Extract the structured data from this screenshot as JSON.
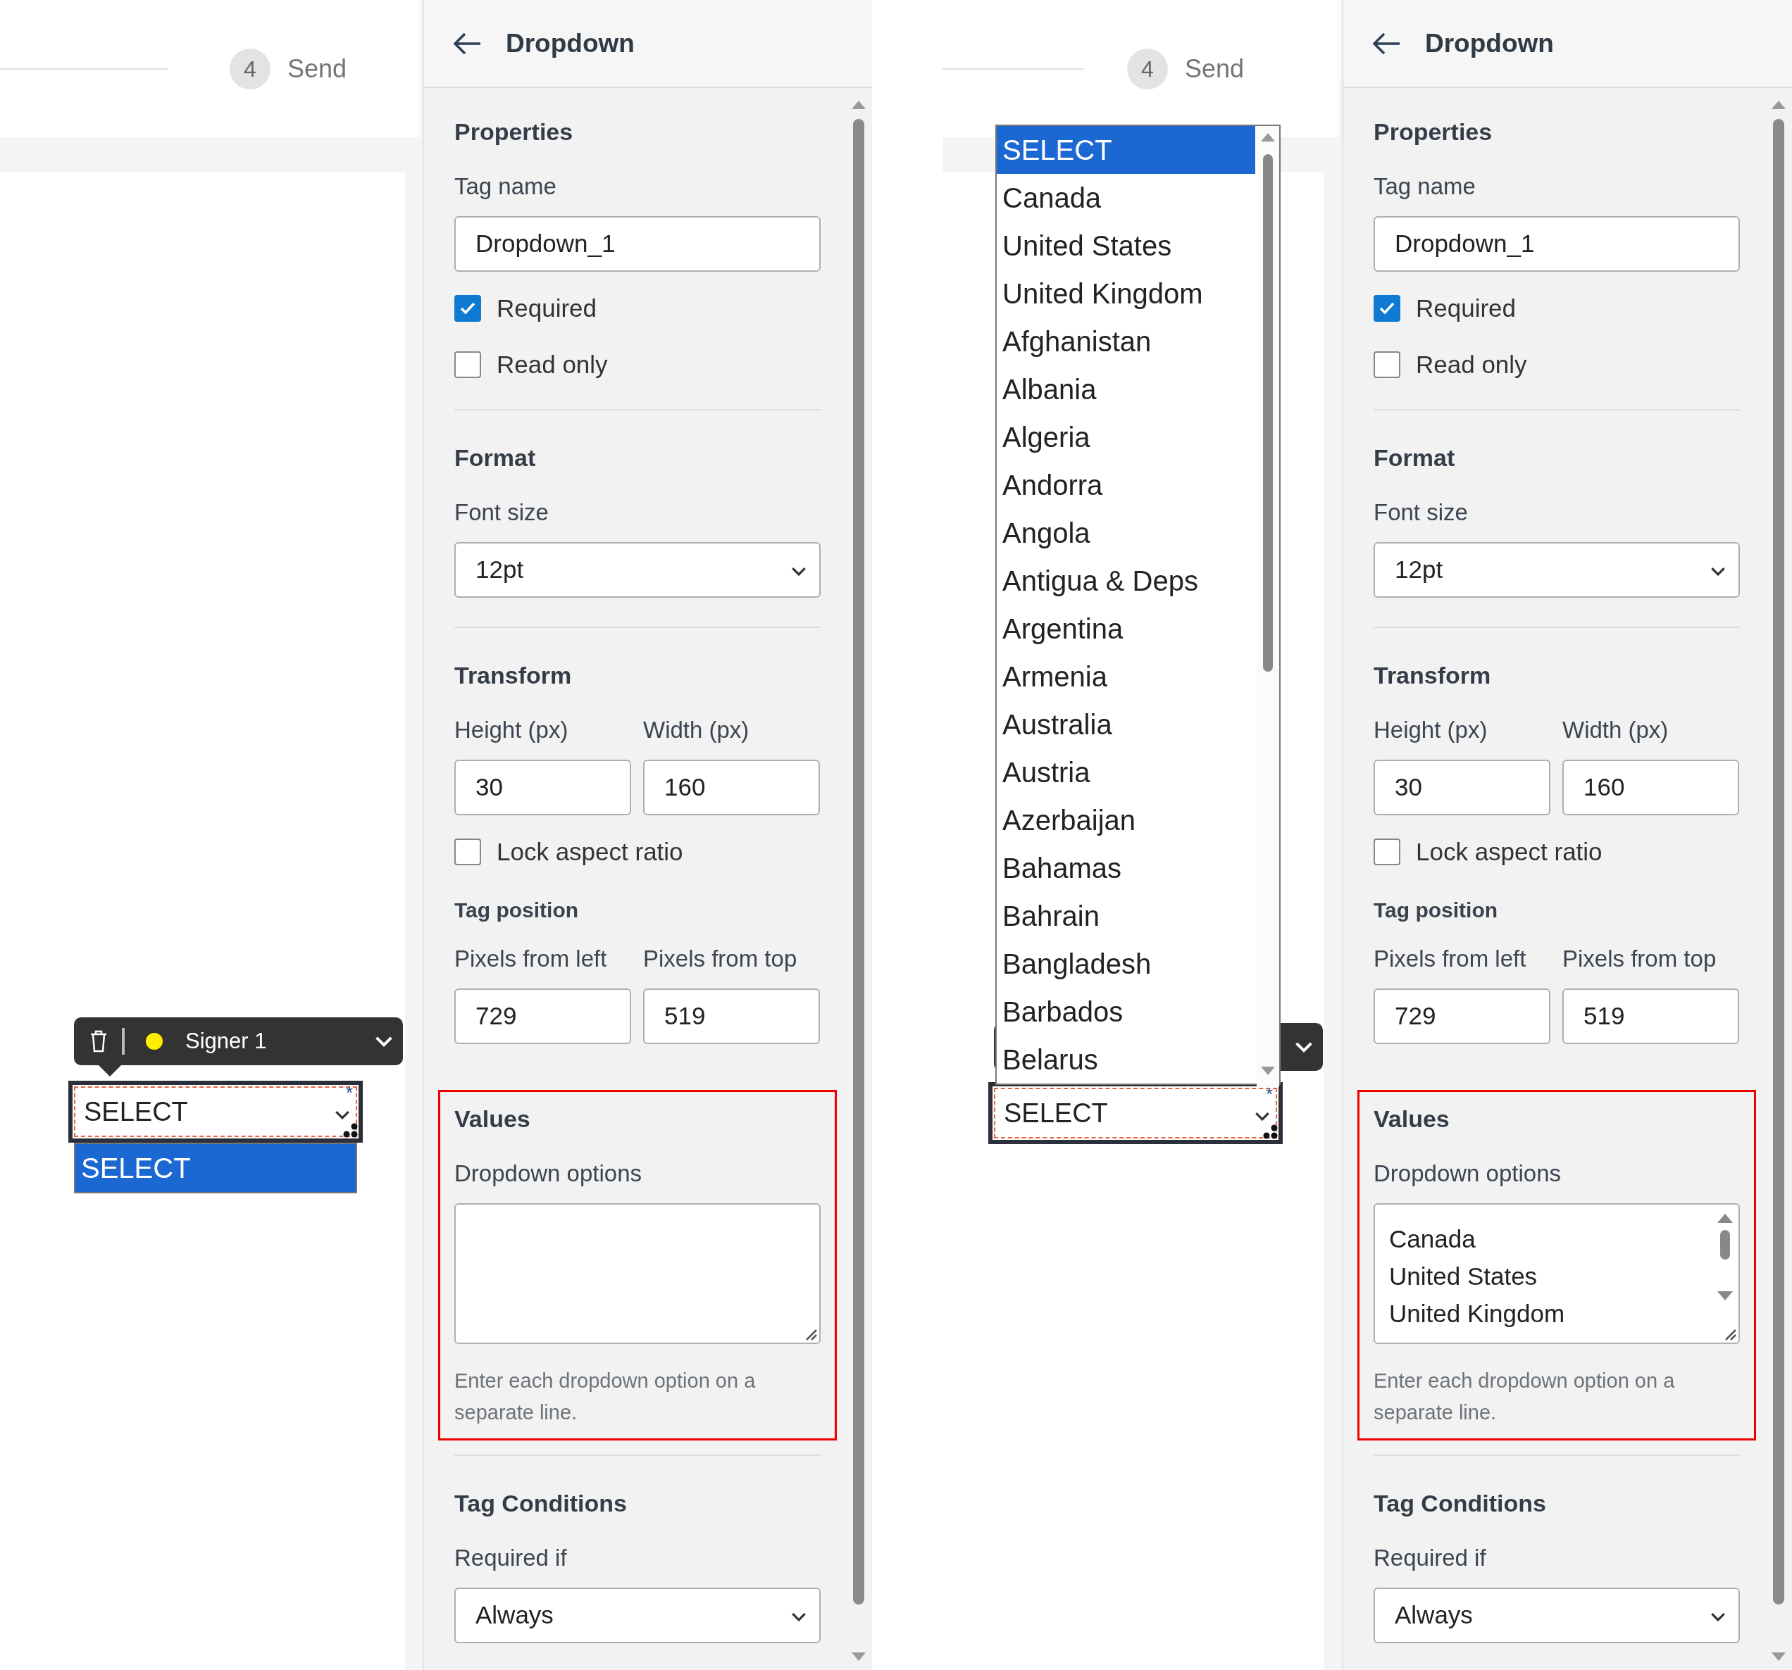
{
  "screens": [
    {
      "stepper": {
        "number": "4",
        "label": "Send"
      },
      "field": {
        "value": "SELECT",
        "required_mark": "*",
        "toolbar": {
          "signer": {
            "name": "Signer 1",
            "color": "#ffee00"
          }
        },
        "list": {
          "kind": "below",
          "scrollbar": false,
          "options": [
            {
              "label": "SELECT",
              "selected": true
            }
          ]
        }
      },
      "panel": {
        "title": "Dropdown",
        "sections": [
          {
            "heading": "Properties",
            "highlighted": false,
            "items": [
              {
                "kind": "text",
                "label": "Tag name",
                "value": "Dropdown_1"
              },
              {
                "kind": "checkbox",
                "label": "Required",
                "checked": true
              },
              {
                "kind": "checkbox",
                "label": "Read only",
                "checked": false
              }
            ]
          },
          {
            "heading": "Format",
            "highlighted": false,
            "items": [
              {
                "kind": "select",
                "label": "Font size",
                "value": "12pt"
              }
            ]
          },
          {
            "heading": "Transform",
            "highlighted": false,
            "items": [
              {
                "kind": "pair",
                "fields": [
                  {
                    "label": "Height (px)",
                    "value": "30"
                  },
                  {
                    "label": "Width (px)",
                    "value": "160"
                  }
                ]
              },
              {
                "kind": "checkbox",
                "label": "Lock aspect ratio",
                "checked": false
              },
              {
                "kind": "subheading",
                "label": "Tag position"
              },
              {
                "kind": "pair",
                "fields": [
                  {
                    "label": "Pixels from left",
                    "value": "729"
                  },
                  {
                    "label": "Pixels from top",
                    "value": "519"
                  }
                ]
              }
            ]
          },
          {
            "heading": "Values",
            "highlighted": true,
            "items": [
              {
                "kind": "textarea",
                "label": "Dropdown options"
              },
              {
                "kind": "hint",
                "text": "Enter each dropdown option on a separate line."
              }
            ]
          },
          {
            "heading": "Tag Conditions",
            "highlighted": false,
            "items": [
              {
                "kind": "select",
                "label": "Required if",
                "value": "Always"
              }
            ]
          }
        ]
      }
    },
    {
      "stepper": {
        "number": "4",
        "label": "Send"
      },
      "field": {
        "value": "SELECT",
        "required_mark": "*",
        "list": {
          "kind": "above",
          "scrollbar": true,
          "options": [
            {
              "label": "SELECT",
              "selected": true
            },
            {
              "label": "Canada",
              "selected": false
            },
            {
              "label": "United States",
              "selected": false
            },
            {
              "label": "United Kingdom",
              "selected": false
            },
            {
              "label": "Afghanistan",
              "selected": false
            },
            {
              "label": "Albania",
              "selected": false
            },
            {
              "label": "Algeria",
              "selected": false
            },
            {
              "label": "Andorra",
              "selected": false
            },
            {
              "label": "Angola",
              "selected": false
            },
            {
              "label": "Antigua & Deps",
              "selected": false
            },
            {
              "label": "Argentina",
              "selected": false
            },
            {
              "label": "Armenia",
              "selected": false
            },
            {
              "label": "Australia",
              "selected": false
            },
            {
              "label": "Austria",
              "selected": false
            },
            {
              "label": "Azerbaijan",
              "selected": false
            },
            {
              "label": "Bahamas",
              "selected": false
            },
            {
              "label": "Bahrain",
              "selected": false
            },
            {
              "label": "Bangladesh",
              "selected": false
            },
            {
              "label": "Barbados",
              "selected": false
            },
            {
              "label": "Belarus",
              "selected": false
            }
          ]
        }
      },
      "panel": {
        "title": "Dropdown",
        "sections": [
          {
            "heading": "Properties",
            "highlighted": false,
            "items": [
              {
                "kind": "text",
                "label": "Tag name",
                "value": "Dropdown_1"
              },
              {
                "kind": "checkbox",
                "label": "Required",
                "checked": true
              },
              {
                "kind": "checkbox",
                "label": "Read only",
                "checked": false
              }
            ]
          },
          {
            "heading": "Format",
            "highlighted": false,
            "items": [
              {
                "kind": "select",
                "label": "Font size",
                "value": "12pt"
              }
            ]
          },
          {
            "heading": "Transform",
            "highlighted": false,
            "items": [
              {
                "kind": "pair",
                "fields": [
                  {
                    "label": "Height (px)",
                    "value": "30"
                  },
                  {
                    "label": "Width (px)",
                    "value": "160"
                  }
                ]
              },
              {
                "kind": "checkbox",
                "label": "Lock aspect ratio",
                "checked": false
              },
              {
                "kind": "subheading",
                "label": "Tag position"
              },
              {
                "kind": "pair",
                "fields": [
                  {
                    "label": "Pixels from left",
                    "value": "729"
                  },
                  {
                    "label": "Pixels from top",
                    "value": "519"
                  }
                ]
              }
            ]
          },
          {
            "heading": "Values",
            "highlighted": true,
            "items": [
              {
                "kind": "textarea",
                "label": "Dropdown options",
                "lines": [
                  "Canada",
                  "United States",
                  "United Kingdom"
                ]
              },
              {
                "kind": "hint",
                "text": "Enter each dropdown option on a separate line."
              }
            ]
          },
          {
            "heading": "Tag Conditions",
            "highlighted": false,
            "items": [
              {
                "kind": "select",
                "label": "Required if",
                "value": "Always"
              }
            ]
          }
        ]
      }
    }
  ]
}
